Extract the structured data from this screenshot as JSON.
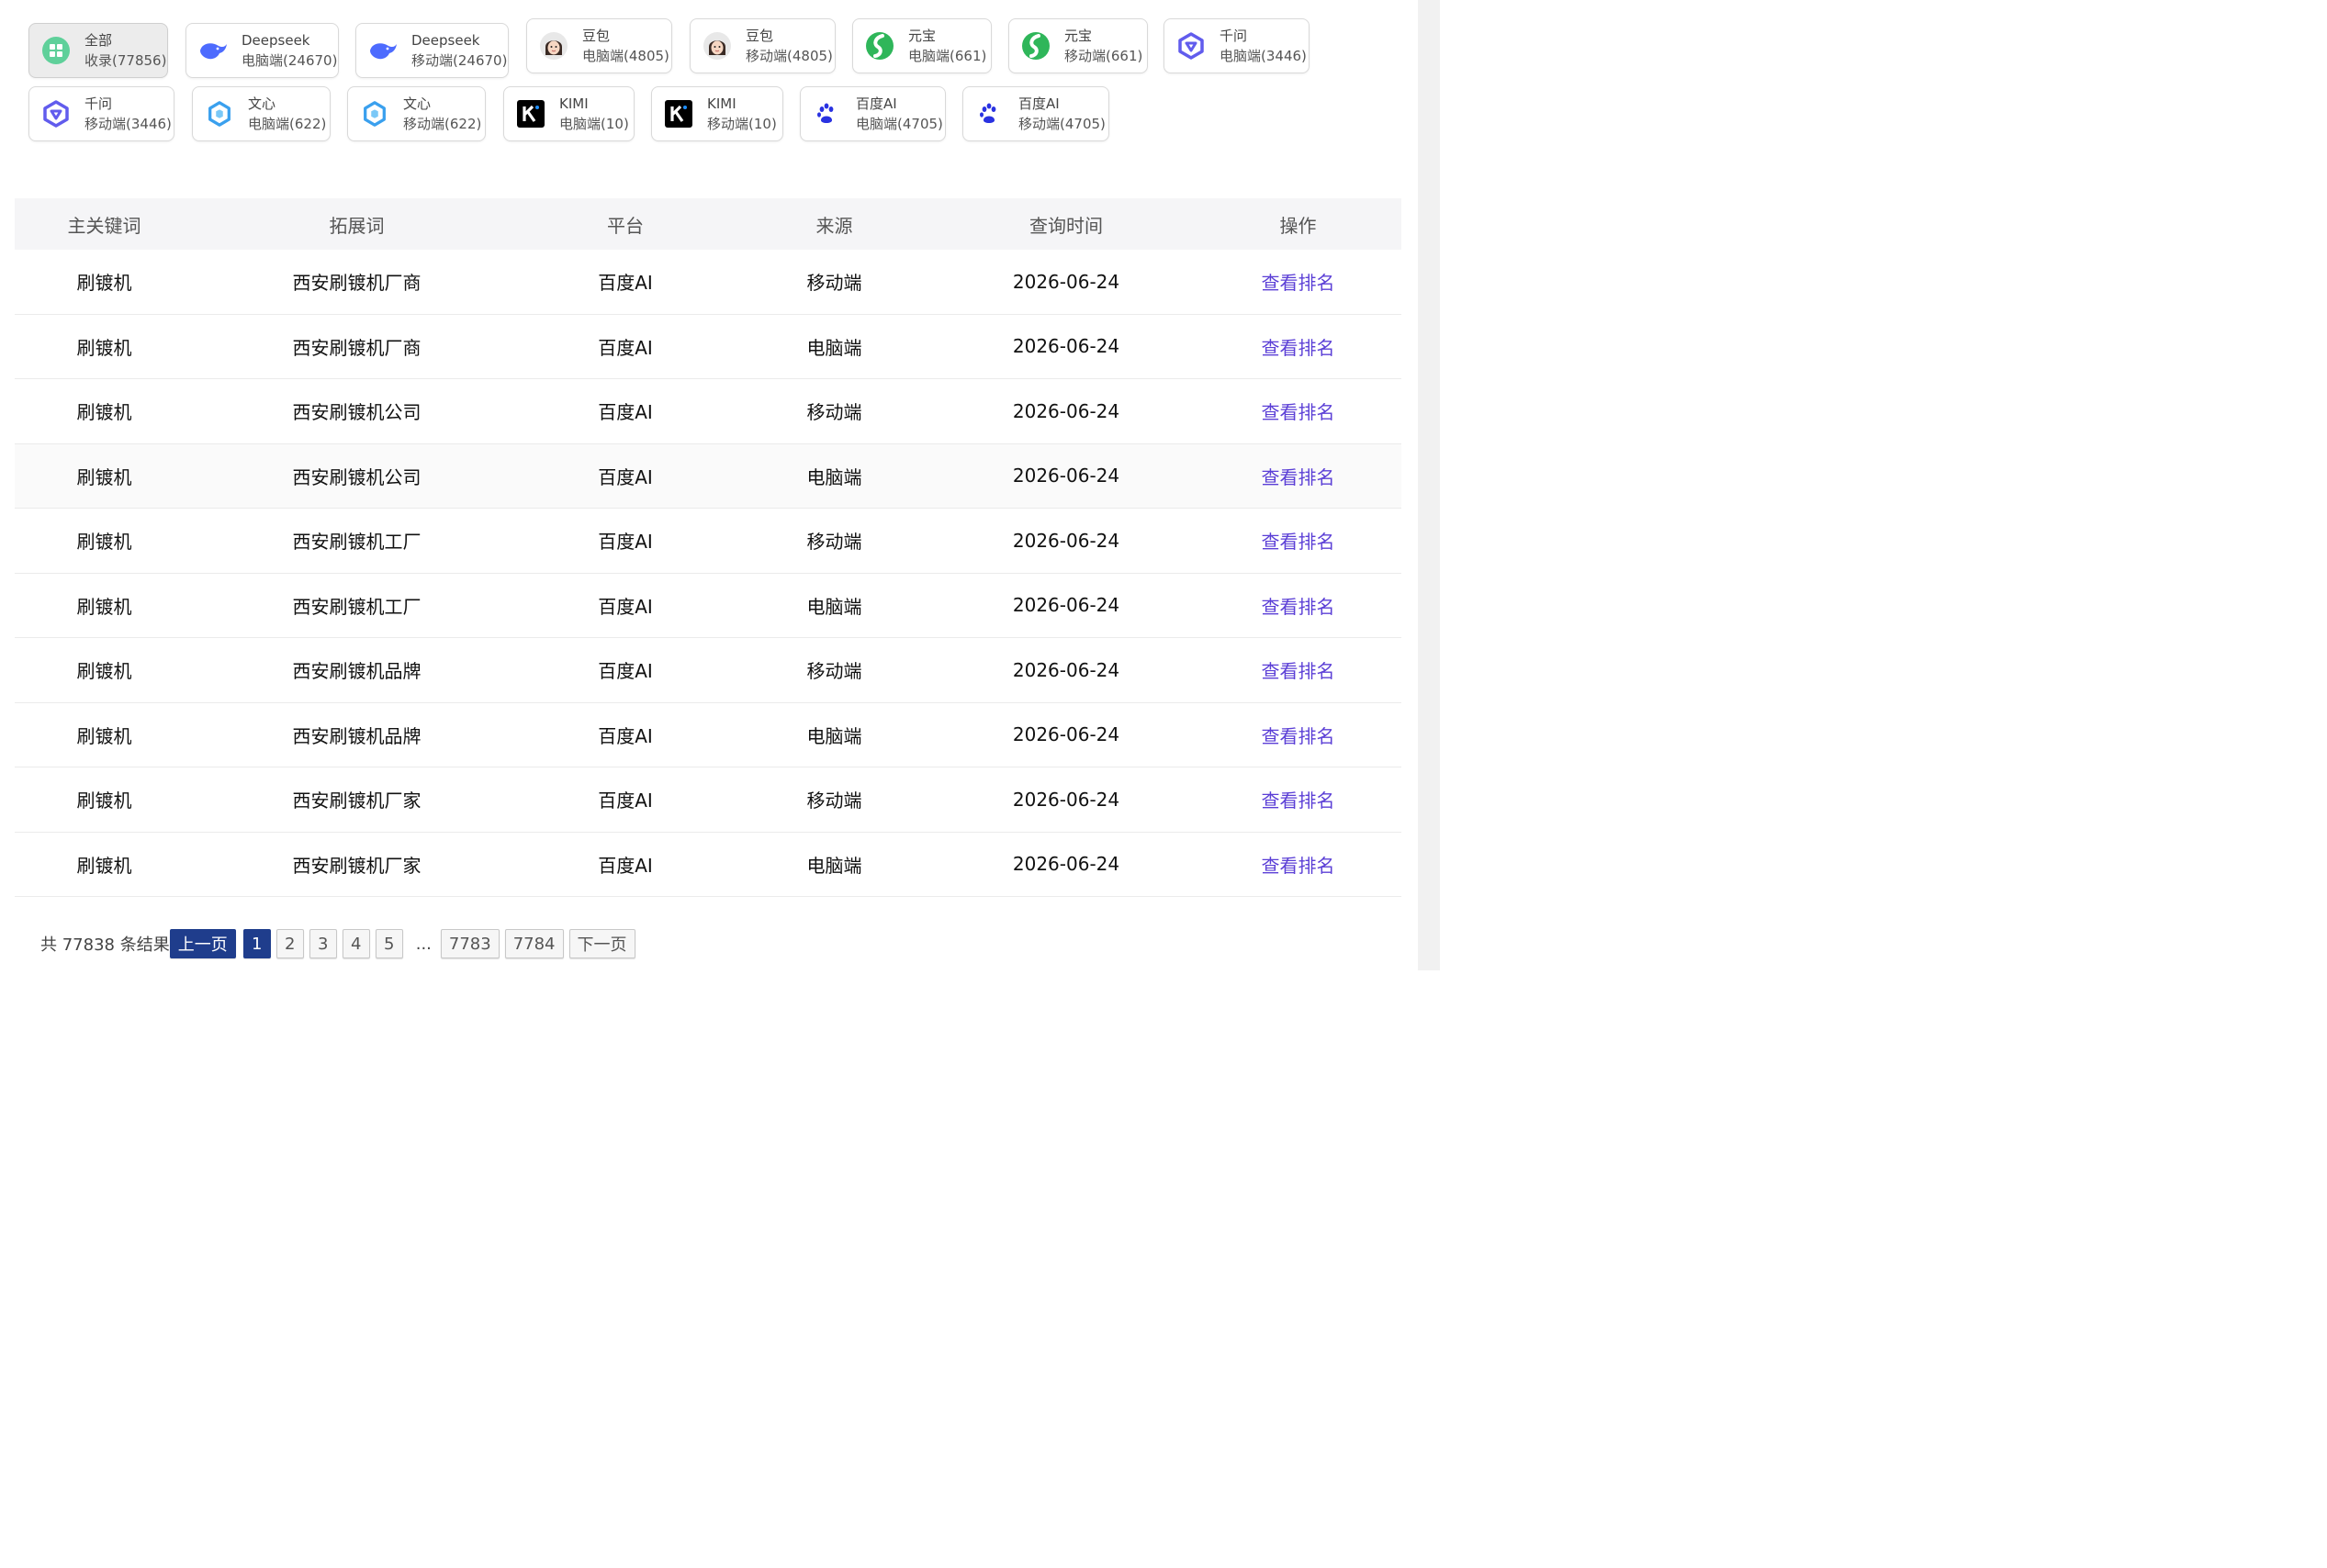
{
  "colors": {
    "accent": "#5b3fd6",
    "pager_active": "#1f3d8c",
    "header_bg": "#f5f5f7"
  },
  "filters": [
    {
      "name": "全部",
      "sub": "收录(77856)",
      "icon": "grid-icon",
      "active": true
    },
    {
      "name": "Deepseek",
      "sub": "电脑端(24670)",
      "icon": "deepseek-whale-icon"
    },
    {
      "name": "Deepseek",
      "sub": "移动端(24670)",
      "icon": "deepseek-whale-icon"
    },
    {
      "name": "豆包",
      "sub": "电脑端(4805)",
      "icon": "doubao-avatar-icon"
    },
    {
      "name": "豆包",
      "sub": "移动端(4805)",
      "icon": "doubao-avatar-icon"
    },
    {
      "name": "元宝",
      "sub": "电脑端(661)",
      "icon": "yuanbao-icon"
    },
    {
      "name": "元宝",
      "sub": "移动端(661)",
      "icon": "yuanbao-icon"
    },
    {
      "name": "千问",
      "sub": "电脑端(3446)",
      "icon": "qianwen-icon"
    },
    {
      "name": "千问",
      "sub": "移动端(3446)",
      "icon": "qianwen-icon"
    },
    {
      "name": "文心",
      "sub": "电脑端(622)",
      "icon": "wenxin-icon"
    },
    {
      "name": "文心",
      "sub": "移动端(622)",
      "icon": "wenxin-icon"
    },
    {
      "name": "KIMI",
      "sub": "电脑端(10)",
      "icon": "kimi-icon"
    },
    {
      "name": "KIMI",
      "sub": "移动端(10)",
      "icon": "kimi-icon"
    },
    {
      "name": "百度AI",
      "sub": "电脑端(4705)",
      "icon": "baidu-paw-icon"
    },
    {
      "name": "百度AI",
      "sub": "移动端(4705)",
      "icon": "baidu-paw-icon"
    }
  ],
  "table": {
    "headers": [
      "主关键词",
      "拓展词",
      "平台",
      "来源",
      "查询时间",
      "操作"
    ],
    "rows": [
      [
        "刷镀机",
        "西安刷镀机厂商",
        "百度AI",
        "移动端",
        "2026-06-24",
        "查看排名"
      ],
      [
        "刷镀机",
        "西安刷镀机厂商",
        "百度AI",
        "电脑端",
        "2026-06-24",
        "查看排名"
      ],
      [
        "刷镀机",
        "西安刷镀机公司",
        "百度AI",
        "移动端",
        "2026-06-24",
        "查看排名"
      ],
      [
        "刷镀机",
        "西安刷镀机公司",
        "百度AI",
        "电脑端",
        "2026-06-24",
        "查看排名"
      ],
      [
        "刷镀机",
        "西安刷镀机工厂",
        "百度AI",
        "移动端",
        "2026-06-24",
        "查看排名"
      ],
      [
        "刷镀机",
        "西安刷镀机工厂",
        "百度AI",
        "电脑端",
        "2026-06-24",
        "查看排名"
      ],
      [
        "刷镀机",
        "西安刷镀机品牌",
        "百度AI",
        "移动端",
        "2026-06-24",
        "查看排名"
      ],
      [
        "刷镀机",
        "西安刷镀机品牌",
        "百度AI",
        "电脑端",
        "2026-06-24",
        "查看排名"
      ],
      [
        "刷镀机",
        "西安刷镀机厂家",
        "百度AI",
        "移动端",
        "2026-06-24",
        "查看排名"
      ],
      [
        "刷镀机",
        "西安刷镀机厂家",
        "百度AI",
        "电脑端",
        "2026-06-24",
        "查看排名"
      ]
    ]
  },
  "pagination": {
    "total": "共 77838 条结果",
    "prev": "上一页",
    "pages": [
      "1",
      "2",
      "3",
      "4",
      "5"
    ],
    "ellipsis": "...",
    "last_pages": [
      "7783",
      "7784"
    ],
    "next": "下一页",
    "current": "1"
  }
}
